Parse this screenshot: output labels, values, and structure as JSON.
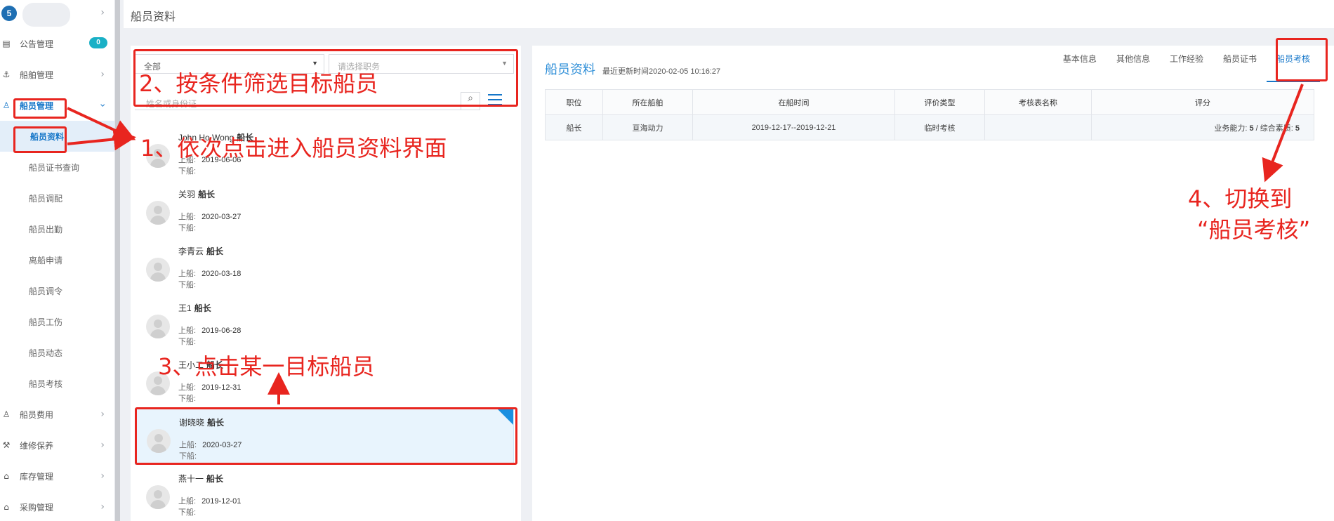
{
  "sidebar": {
    "logo_text": "5",
    "items": [
      {
        "label": "公告管理",
        "icon": "book-icon",
        "badge": "0"
      },
      {
        "label": "船舶管理",
        "icon": "anchor-icon"
      },
      {
        "label": "船员管理",
        "icon": "user-icon"
      }
    ],
    "sub_items": [
      {
        "label": "船员资料"
      },
      {
        "label": "船员证书查询"
      },
      {
        "label": "船员调配"
      },
      {
        "label": "船员出勤"
      },
      {
        "label": "离船申请"
      },
      {
        "label": "船员调令"
      },
      {
        "label": "船员工伤"
      },
      {
        "label": "船员动态"
      },
      {
        "label": "船员考核"
      }
    ],
    "items_bottom": [
      {
        "label": "船员费用",
        "icon": "user-icon"
      },
      {
        "label": "维修保养",
        "icon": "wrench-icon"
      },
      {
        "label": "库存管理",
        "icon": "bag-icon"
      },
      {
        "label": "采购管理",
        "icon": "bag-icon"
      }
    ]
  },
  "header": {
    "title": "船员资料"
  },
  "filters": {
    "scope_value": "全部",
    "position_placeholder": "请选择职务",
    "search_placeholder": "姓名或身份证"
  },
  "crew_list": [
    {
      "name": "John Ho Wong",
      "rank": "船长",
      "on_label": "上船:",
      "on_date": "2019-06-06",
      "off_label": "下船:"
    },
    {
      "name": "关羽",
      "rank": "船长",
      "on_label": "上船:",
      "on_date": "2020-03-27",
      "off_label": "下船:"
    },
    {
      "name": "李青云",
      "rank": "船长",
      "on_label": "上船:",
      "on_date": "2020-03-18",
      "off_label": "下船:"
    },
    {
      "name": "王1",
      "rank": "船长",
      "on_label": "上船:",
      "on_date": "2019-06-28",
      "off_label": "下船:"
    },
    {
      "name": "王小二",
      "rank": "船长",
      "on_label": "上船:",
      "on_date": "2019-12-31",
      "off_label": "下船:"
    },
    {
      "name": "谢晓晓",
      "rank": "船长",
      "on_label": "上船:",
      "on_date": "2020-03-27",
      "off_label": "下船:"
    },
    {
      "name": "燕十一",
      "rank": "船长",
      "on_label": "上船:",
      "on_date": "2019-12-01",
      "off_label": "下船:"
    }
  ],
  "detail": {
    "title": "船员资料",
    "updated": "最近更新时间2020-02-05 10:16:27",
    "tabs": [
      "基本信息",
      "其他信息",
      "工作经验",
      "船员证书",
      "船员考核"
    ],
    "active_tab": "船员考核",
    "table": {
      "headers": [
        "职位",
        "所在船舶",
        "在船时间",
        "评价类型",
        "考核表名称",
        "评分"
      ],
      "rows": [
        {
          "position": "船长",
          "ship": "亘海动力",
          "period": "2019-12-17--2019-12-21",
          "type": "临时考核",
          "form": "",
          "score_a_label": "业务能力:",
          "score_a": "5",
          "score_sep": "/ 综合素质:",
          "score_b": "5"
        }
      ]
    }
  },
  "annotations": {
    "step1": "1、依次点击进入船员资料界面",
    "step2": "2、按条件筛选目标船员",
    "step3": "3、点击某一目标船员",
    "step4_line1": "4、切换到",
    "step4_line2": "“船员考核”",
    "color": "#e8251f"
  }
}
